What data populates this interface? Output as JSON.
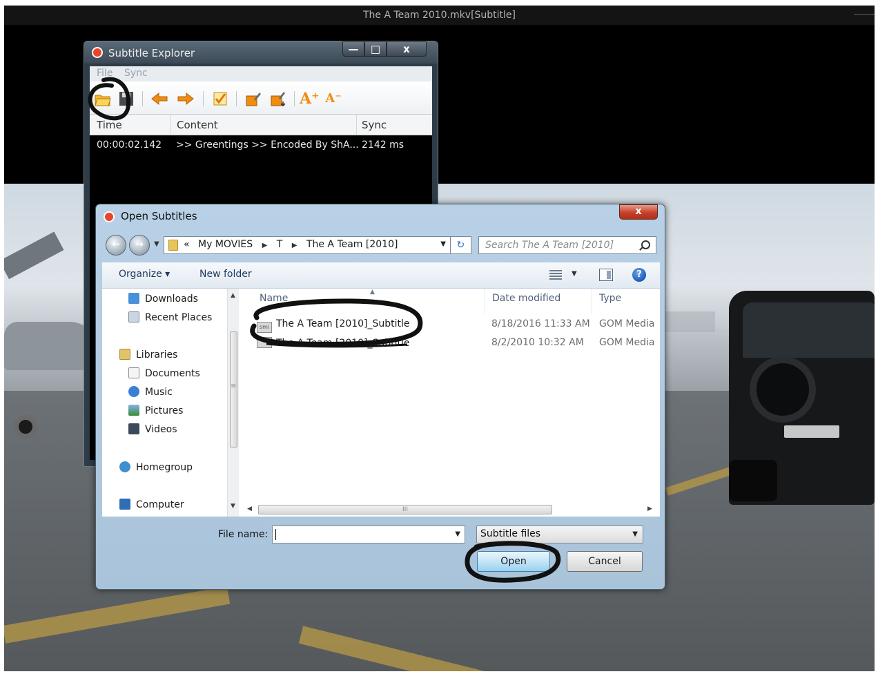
{
  "player": {
    "title": "The A Team 2010.mkv[Subtitle]"
  },
  "subtitle_explorer": {
    "title": "Subtitle Explorer",
    "menu": [
      "File",
      "Sync"
    ],
    "window_controls": {
      "minimize": "—",
      "maximize": "□",
      "close": "x"
    },
    "toolbar_icons": [
      "open-folder-icon",
      "save-icon",
      "arrow-left-icon",
      "arrow-right-icon",
      "checkmark-icon",
      "edit-icon",
      "edit-down-icon",
      "font-increase-icon",
      "font-decrease-icon"
    ],
    "toolbar_glyphs": {
      "font_up": "A⁺",
      "font_down": "A⁻"
    },
    "columns": [
      "Time",
      "Content",
      "Sync"
    ],
    "rows": [
      {
        "time": "00:00:02.142",
        "content": ">> Greentings >> Encoded By ShA...",
        "sync": "2142 ms"
      }
    ]
  },
  "open_dialog": {
    "title": "Open Subtitles",
    "close_glyph": "x",
    "breadcrumb_prefix": "«",
    "breadcrumbs": [
      "My MOVIES",
      "T",
      "The A Team [2010]"
    ],
    "search_placeholder": "Search The A Team [2010]",
    "toolbar": {
      "organize": "Organize ▾",
      "new_folder": "New folder",
      "help_glyph": "?"
    },
    "nav": {
      "favorites": [
        "Downloads",
        "Recent Places"
      ],
      "libraries_label": "Libraries",
      "libraries": [
        "Documents",
        "Music",
        "Pictures",
        "Videos"
      ],
      "homegroup": "Homegroup",
      "computer": "Computer"
    },
    "columns": {
      "name": "Name",
      "date_modified": "Date modified",
      "type": "Type"
    },
    "files": [
      {
        "name": "The A Team [2010]_Subtitle",
        "date": "8/18/2016 11:33 AM",
        "type": "GOM Media",
        "icon_label": "smi"
      },
      {
        "name": "The A Team [2010]_Subtitle",
        "date": "8/2/2010 10:32 AM",
        "type": "GOM Media",
        "icon_label": ""
      }
    ],
    "file_name_label": "File name:",
    "file_name_value": "",
    "filter": "Subtitle files",
    "buttons": {
      "open": "Open",
      "cancel": "Cancel"
    },
    "scroll_grip": "III",
    "nav_grip": "≡"
  },
  "colors": {
    "annotation_ink": "#111111",
    "gom_logo": "#e8452c",
    "toolbar_orange": "#f08c10"
  }
}
